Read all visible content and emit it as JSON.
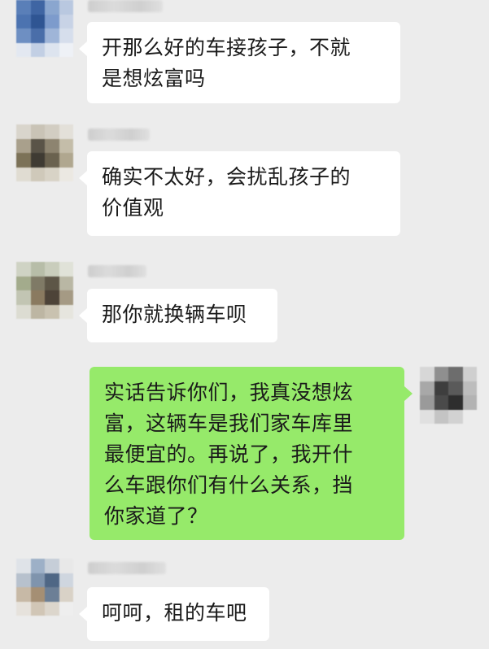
{
  "conversation": {
    "messages": [
      {
        "direction": "incoming",
        "sender_name_blurred": true,
        "text": "开那么好的车接孩子，不就\n是想炫富吗"
      },
      {
        "direction": "incoming",
        "sender_name_blurred": true,
        "text": "确实不太好，会扰乱孩子的\n价值观"
      },
      {
        "direction": "incoming",
        "sender_name_blurred": true,
        "text": "那你就换辆车呗"
      },
      {
        "direction": "outgoing",
        "text": "实话告诉你们，我真没想炫\n富，这辆车是我们家车库里\n最便宜的。再说了，我开什\n么车跟你们有什么关系，挡\n你家道了？"
      },
      {
        "direction": "incoming",
        "sender_name_blurred": true,
        "text": "呵呵，租的车吧"
      }
    ]
  },
  "colors": {
    "background": "#ececec",
    "incoming_bubble": "#ffffff",
    "outgoing_bubble": "#96ea6a",
    "text": "#1a1a1a"
  },
  "avatars": [
    {
      "style": "pixelated",
      "palette": [
        "#5a7fb8",
        "#3f65a3",
        "#8aa6cf",
        "#b9c8e0",
        "#4c73b0",
        "#2f5593",
        "#7d9bcc",
        "#c8d3e6",
        "#6e8fc2",
        "#4a6ea9",
        "#9fb5d8",
        "#d6deec",
        "#e3e8f1",
        "#c2cfe4",
        "#dde4ef",
        "#eef1f6"
      ]
    },
    {
      "style": "pixelated",
      "palette": [
        "#d9d5cc",
        "#c9c3b6",
        "#d2cdc2",
        "#e3e0d9",
        "#a9a08c",
        "#5a5448",
        "#8d8470",
        "#c4bda9",
        "#7c7258",
        "#3f3b33",
        "#6a624f",
        "#b0a78f",
        "#e0dcd2",
        "#cfc9ba",
        "#d8d3c6",
        "#ebe8e2"
      ]
    },
    {
      "style": "pixelated",
      "palette": [
        "#cfd3c4",
        "#b7bda8",
        "#c9cdbc",
        "#e0e2d8",
        "#a3ab8c",
        "#7f7a66",
        "#5d5647",
        "#b9b7a4",
        "#c2c5b3",
        "#8a7a60",
        "#4d4338",
        "#a59a84",
        "#dcdcd2",
        "#bdb6a3",
        "#c9c2b0",
        "#e6e5de"
      ]
    },
    {
      "style": "pixelated",
      "palette": [
        "#d7d7d7",
        "#8f8f8f",
        "#6d6d6d",
        "#cfcfcf",
        "#a8a8a8",
        "#3e3e3e",
        "#5a5a5a",
        "#bdbdbd",
        "#9a9a9a",
        "#4a4a4a",
        "#2e2e2e",
        "#b3b3b3",
        "#e0e0e0",
        "#c4c4c4",
        "#d2d2d2",
        "#ececec"
      ]
    },
    {
      "style": "pixelated",
      "palette": [
        "#dfe3e8",
        "#9db0c7",
        "#c6ced8",
        "#e8e8e8",
        "#b7c1cd",
        "#7f94ad",
        "#4f6785",
        "#cfd6df",
        "#c7b9a6",
        "#a58f74",
        "#6c7f96",
        "#d9d2c7",
        "#e6e2dc",
        "#d1c6b6",
        "#dcd6cc",
        "#eeeeee"
      ]
    }
  ]
}
